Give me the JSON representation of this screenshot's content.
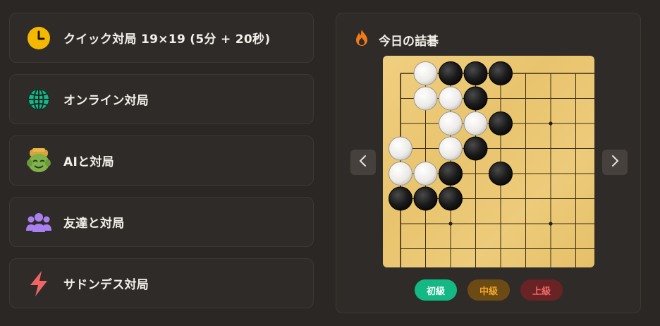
{
  "menu": {
    "items": [
      {
        "label": "クイック対局 19×19 (5分 + 20秒)",
        "icon": "clock-icon"
      },
      {
        "label": "オンライン対局",
        "icon": "globe-icon"
      },
      {
        "label": "AIと対局",
        "icon": "ai-robot-icon"
      },
      {
        "label": "友達と対局",
        "icon": "friends-icon"
      },
      {
        "label": "サドンデス対局",
        "icon": "lightning-icon"
      }
    ]
  },
  "puzzle": {
    "title": "今日の詰碁",
    "title_icon": "fire-icon",
    "prev_icon": "chevron-left-icon",
    "next_icon": "chevron-right-icon",
    "stones": {
      "white": [
        [
          1,
          0
        ],
        [
          1,
          1
        ],
        [
          2,
          1
        ],
        [
          2,
          2
        ],
        [
          3,
          2
        ],
        [
          0,
          3
        ],
        [
          2,
          3
        ],
        [
          0,
          4
        ],
        [
          1,
          4
        ]
      ],
      "black": [
        [
          2,
          0
        ],
        [
          3,
          0
        ],
        [
          4,
          0
        ],
        [
          3,
          1
        ],
        [
          4,
          2
        ],
        [
          3,
          3
        ],
        [
          2,
          4
        ],
        [
          4,
          4
        ],
        [
          0,
          5
        ],
        [
          1,
          5
        ],
        [
          2,
          5
        ]
      ]
    },
    "star_points": [
      [
        6,
        2
      ],
      [
        2,
        6
      ],
      [
        6,
        6
      ]
    ]
  },
  "difficulty": {
    "items": [
      {
        "label": "初級",
        "bg": "#13b885",
        "fg": "#ffffff"
      },
      {
        "label": "中級",
        "bg": "#6b4a14",
        "fg": "#f0a62a"
      },
      {
        "label": "上級",
        "bg": "#6a2325",
        "fg": "#f06868"
      }
    ]
  }
}
